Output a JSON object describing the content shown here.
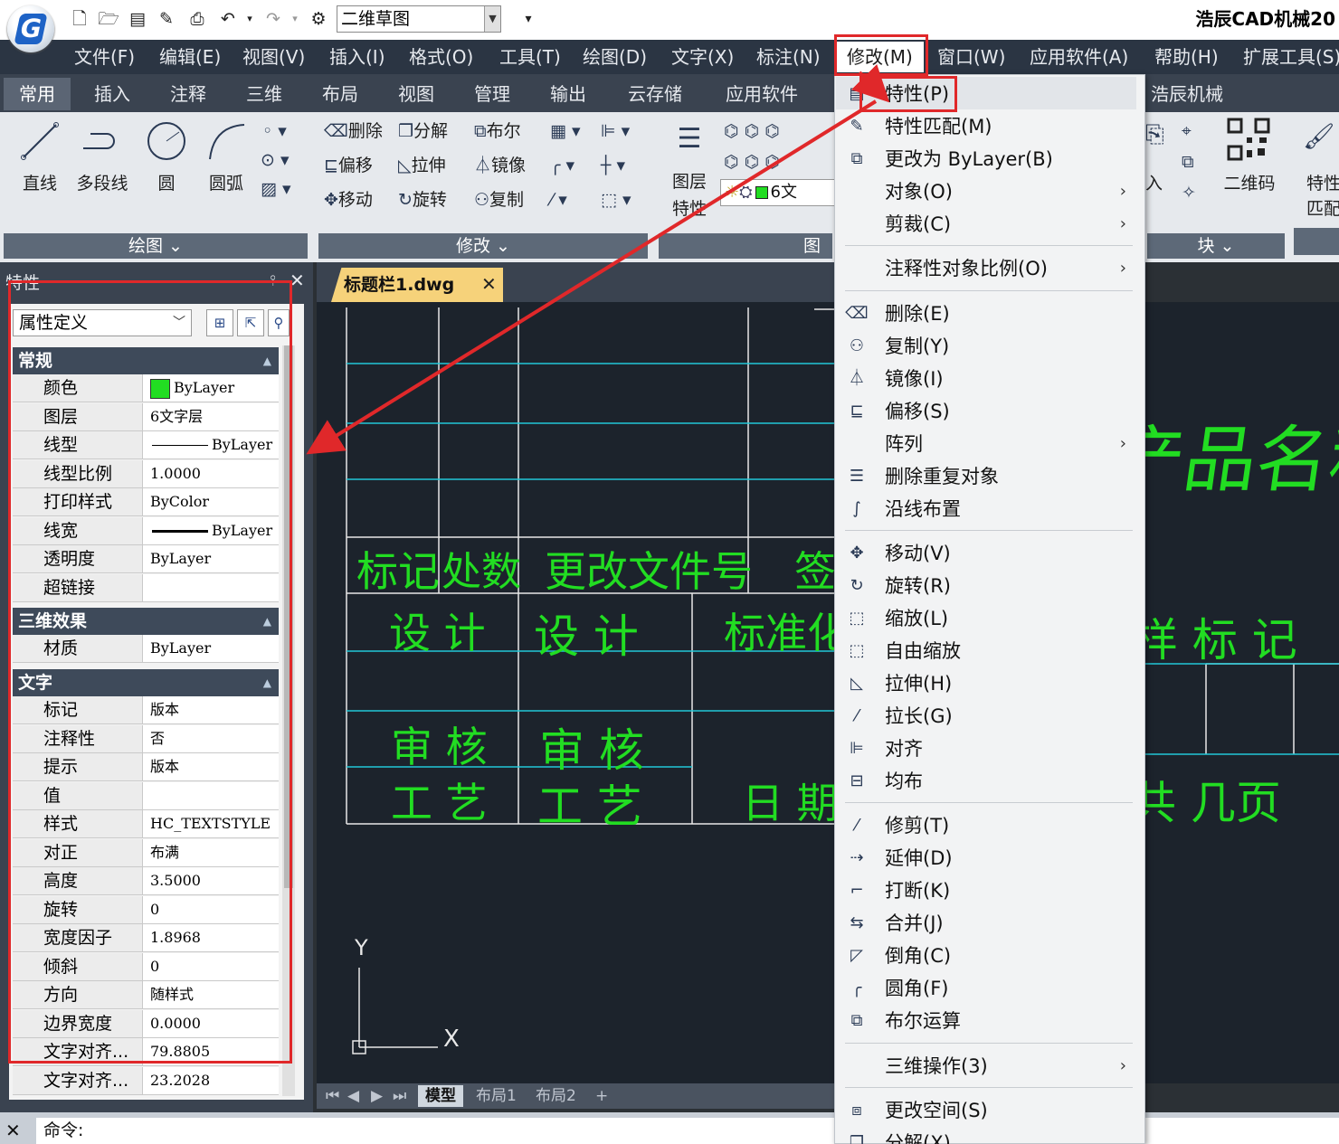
{
  "app": {
    "title": "浩辰CAD机械20",
    "workspace": "二维草图",
    "logo_letter": "G"
  },
  "menubar": [
    "文件(F)",
    "编辑(E)",
    "视图(V)",
    "插入(I)",
    "格式(O)",
    "工具(T)",
    "绘图(D)",
    "文字(X)",
    "标注(N)",
    "修改(M)",
    "窗口(W)",
    "应用软件(A)",
    "帮助(H)",
    "扩展工具(S)"
  ],
  "ribbon_tabs": [
    "常用",
    "插入",
    "注释",
    "三维",
    "布局",
    "视图",
    "管理",
    "输出",
    "云存储",
    "应用软件",
    "浩辰机械"
  ],
  "ribbon": {
    "draw": {
      "title": "绘图",
      "buttons": [
        "直线",
        "多段线",
        "圆",
        "圆弧"
      ]
    },
    "modify": {
      "title": "修改",
      "rows": [
        [
          "删除",
          "分解",
          "布尔"
        ],
        [
          "偏移",
          "拉伸",
          "镜像"
        ],
        [
          "移动",
          "旋转",
          "复制"
        ]
      ]
    },
    "layer": {
      "title": "图层",
      "button1": "图层",
      "button2": "特性",
      "layer_combo": "6文"
    },
    "block": {
      "title": "块",
      "insert": "入",
      "qrcode": "二维码"
    },
    "match": {
      "label1": "特性",
      "label2": "匹配"
    }
  },
  "properties": {
    "title": "特性",
    "object_type": "属性定义",
    "sections": {
      "general": "常规",
      "three_d": "三维效果",
      "text": "文字"
    },
    "general": [
      {
        "k": "颜色",
        "v": "ByLayer"
      },
      {
        "k": "图层",
        "v": "6文字层"
      },
      {
        "k": "线型",
        "v": "ByLayer"
      },
      {
        "k": "线型比例",
        "v": "1.0000"
      },
      {
        "k": "打印样式",
        "v": "ByColor"
      },
      {
        "k": "线宽",
        "v": "ByLayer"
      },
      {
        "k": "透明度",
        "v": "ByLayer"
      },
      {
        "k": "超链接",
        "v": ""
      }
    ],
    "three_d": [
      {
        "k": "材质",
        "v": "ByLayer"
      }
    ],
    "text": [
      {
        "k": "标记",
        "v": "版本"
      },
      {
        "k": "注释性",
        "v": "否"
      },
      {
        "k": "提示",
        "v": "版本"
      },
      {
        "k": "值",
        "v": ""
      },
      {
        "k": "样式",
        "v": "HC_TEXTSTYLE"
      },
      {
        "k": "对正",
        "v": "布满"
      },
      {
        "k": "高度",
        "v": "3.5000"
      },
      {
        "k": "旋转",
        "v": "0"
      },
      {
        "k": "宽度因子",
        "v": "1.8968"
      },
      {
        "k": "倾斜",
        "v": "0"
      },
      {
        "k": "方向",
        "v": "随样式"
      },
      {
        "k": "边界宽度",
        "v": "0.0000"
      },
      {
        "k": "文字对齐...",
        "v": "79.8805"
      },
      {
        "k": "文字对齐...",
        "v": "23.2028"
      }
    ]
  },
  "document": {
    "tab": "标题栏1.dwg",
    "layout_tabs": [
      "模型",
      "布局1",
      "布局2",
      "+"
    ],
    "axis_y": "Y",
    "axis_x": "X",
    "drawing_texts": {
      "biaoji": "标记",
      "chushu": "处数",
      "genggai": "更改文件号",
      "qian": "签",
      "sheji1": "设 计",
      "sheji2": "设 计",
      "biaozhunhua": "标准化",
      "shenhe1": "审 核",
      "shenhe2": "审 核",
      "gongyi1": "工 艺",
      "gongyi2": "工 艺",
      "riqi": "日 期",
      "chanpin": "产品名称",
      "yangbiaoji": "样 标 记",
      "gongye": "共 几页"
    }
  },
  "command": {
    "prompt": "命令:"
  },
  "modify_menu": [
    {
      "label": "特性(P)",
      "icon": "properties-icon",
      "sub": false
    },
    {
      "label": "特性匹配(M)",
      "icon": "match-properties-icon",
      "sub": false
    },
    {
      "label": "更改为 ByLayer(B)",
      "icon": "bylayer-icon",
      "sub": false
    },
    {
      "label": "对象(O)",
      "icon": "",
      "sub": true
    },
    {
      "label": "剪裁(C)",
      "icon": "",
      "sub": true
    },
    {
      "label": "注释性对象比例(O)",
      "icon": "",
      "sub": true
    },
    {
      "label": "删除(E)",
      "icon": "erase-icon",
      "sub": false
    },
    {
      "label": "复制(Y)",
      "icon": "copy-icon",
      "sub": false
    },
    {
      "label": "镜像(I)",
      "icon": "mirror-icon",
      "sub": false
    },
    {
      "label": "偏移(S)",
      "icon": "offset-icon",
      "sub": false
    },
    {
      "label": "阵列",
      "icon": "",
      "sub": true
    },
    {
      "label": "删除重复对象",
      "icon": "overkill-icon",
      "sub": false
    },
    {
      "label": "沿线布置",
      "icon": "measure-icon",
      "sub": false
    },
    {
      "label": "移动(V)",
      "icon": "move-icon",
      "sub": false
    },
    {
      "label": "旋转(R)",
      "icon": "rotate-icon",
      "sub": false
    },
    {
      "label": "缩放(L)",
      "icon": "scale-icon",
      "sub": false
    },
    {
      "label": "自由缩放",
      "icon": "free-scale-icon",
      "sub": false
    },
    {
      "label": "拉伸(H)",
      "icon": "stretch-icon",
      "sub": false
    },
    {
      "label": "拉长(G)",
      "icon": "lengthen-icon",
      "sub": false
    },
    {
      "label": "对齐",
      "icon": "align-icon",
      "sub": false
    },
    {
      "label": "均布",
      "icon": "distribute-icon",
      "sub": false
    },
    {
      "label": "修剪(T)",
      "icon": "trim-icon",
      "sub": false
    },
    {
      "label": "延伸(D)",
      "icon": "extend-icon",
      "sub": false
    },
    {
      "label": "打断(K)",
      "icon": "break-icon",
      "sub": false
    },
    {
      "label": "合并(J)",
      "icon": "join-icon",
      "sub": false
    },
    {
      "label": "倒角(C)",
      "icon": "chamfer-icon",
      "sub": false
    },
    {
      "label": "圆角(F)",
      "icon": "fillet-icon",
      "sub": false
    },
    {
      "label": "布尔运算",
      "icon": "boolean-icon",
      "sub": false
    },
    {
      "label": "三维操作(3)",
      "icon": "",
      "sub": true
    },
    {
      "label": "更改空间(S)",
      "icon": "change-space-icon",
      "sub": false
    },
    {
      "label": "分解(X)",
      "icon": "explode-icon",
      "sub": false
    }
  ],
  "colors": {
    "accent_red": "#e0282a",
    "cad_green": "#22dd22",
    "cad_cyan": "#22c8d8",
    "menubar": "#2b3543"
  }
}
